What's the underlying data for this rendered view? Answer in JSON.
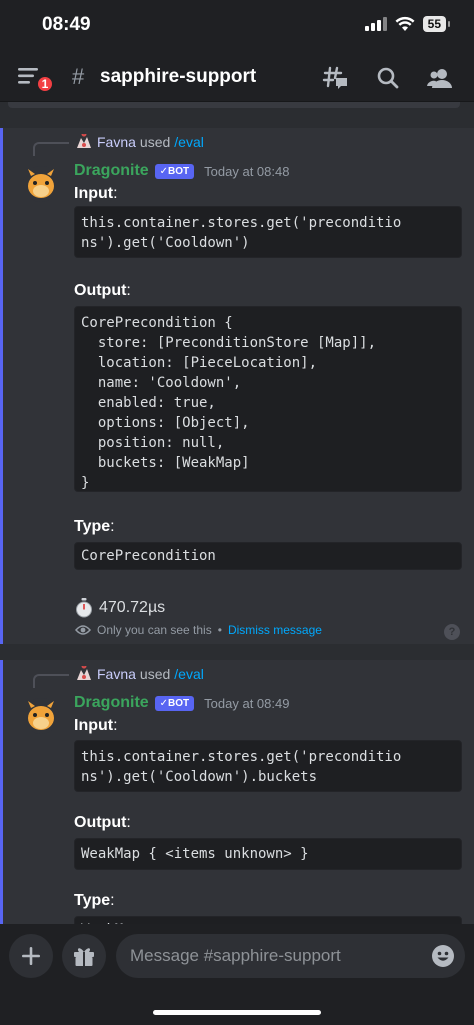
{
  "status_bar": {
    "time": "08:49",
    "battery": "55"
  },
  "header": {
    "unread_badge": "1",
    "hash": "#",
    "channel_name": "sapphire-support"
  },
  "messages": [
    {
      "reply": {
        "user": "Favna",
        "used": "used",
        "command": "/eval"
      },
      "author": "Dragonite",
      "bot_tag": "✓BOT",
      "timestamp": "Today at 08:48",
      "input_label": "Input",
      "input_code": "this.container.stores.get('preconditio\nns').get('Cooldown')",
      "output_label": "Output",
      "output_code": "CorePrecondition {\n  store: [PreconditionStore [Map]],\n  location: [PieceLocation],\n  name: 'Cooldown',\n  enabled: true,\n  options: [Object],\n  position: null,\n  buckets: [WeakMap]\n}",
      "type_label": "Type",
      "type_code": "CorePrecondition",
      "timer": "470.72µs",
      "ephemeral_note": "Only you can see this",
      "dot": "•",
      "dismiss": "Dismiss message",
      "help": "?"
    },
    {
      "reply": {
        "user": "Favna",
        "used": "used",
        "command": "/eval"
      },
      "author": "Dragonite",
      "bot_tag": "✓BOT",
      "timestamp": "Today at 08:49",
      "input_label": "Input",
      "input_code": "this.container.stores.get('preconditio\nns').get('Cooldown').buckets",
      "output_label": "Output",
      "output_code": "WeakMap { <items unknown> }",
      "type_label": "Type",
      "type_code": "WeakMap"
    }
  ],
  "composer": {
    "placeholder": "Message #sapphire-support"
  },
  "colors": {
    "accent": "#5865f2",
    "bot_name": "#3ba55d",
    "link": "#00a8fc",
    "badge": "#f23f43"
  }
}
